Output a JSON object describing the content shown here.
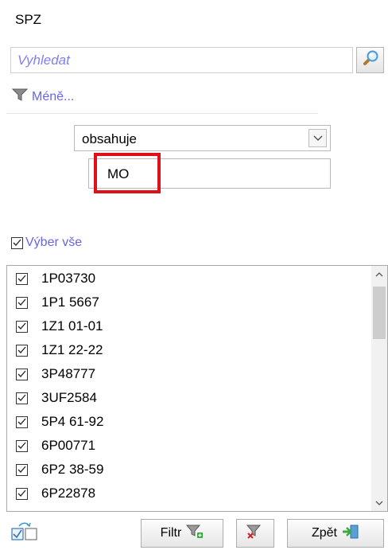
{
  "window": {
    "title": "SPZ"
  },
  "search": {
    "placeholder": "Vyhledat"
  },
  "less_link": {
    "label": "Méně..."
  },
  "condition": {
    "selected": "obsahuje"
  },
  "filter_value": {
    "value": "MO"
  },
  "select_all": {
    "label": "Výber vše",
    "checked": true
  },
  "items": [
    {
      "label": "1P03730",
      "checked": true
    },
    {
      "label": "1P1 5667",
      "checked": true
    },
    {
      "label": "1Z1 01-01",
      "checked": true
    },
    {
      "label": "1Z1 22-22",
      "checked": true
    },
    {
      "label": "3P48777",
      "checked": true
    },
    {
      "label": "3UF2584",
      "checked": true
    },
    {
      "label": "5P4 61-92",
      "checked": true
    },
    {
      "label": "6P00771",
      "checked": true
    },
    {
      "label": "6P2 38-59",
      "checked": true
    },
    {
      "label": "6P22878",
      "checked": true
    }
  ],
  "buttons": {
    "filter": "Filtr",
    "back": "Zpět"
  },
  "colors": {
    "link": "#6565e8",
    "highlight": "#e0101a"
  }
}
